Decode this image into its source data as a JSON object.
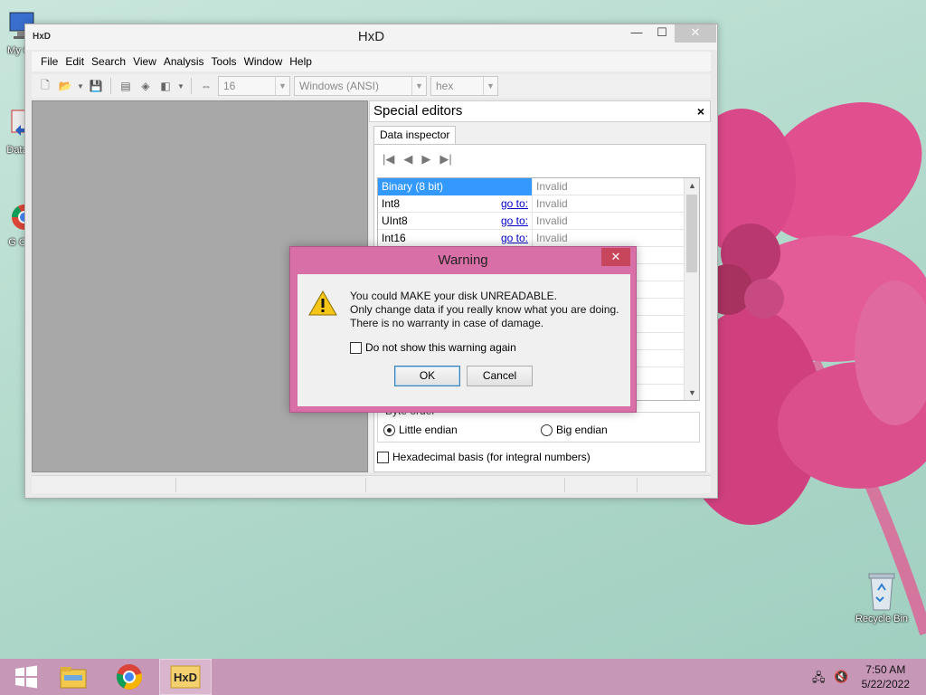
{
  "desktop": {
    "icons": [
      {
        "label": "My C"
      },
      {
        "label": "Data"
      },
      {
        "label": "G C"
      },
      {
        "label": "Recycle Bin"
      }
    ]
  },
  "window": {
    "title": "HxD",
    "app_icon": "HxD",
    "menu": [
      "File",
      "Edit",
      "Search",
      "View",
      "Analysis",
      "Tools",
      "Window",
      "Help"
    ],
    "toolbar": {
      "bytes_per_row": "16",
      "charset": "Windows (ANSI)",
      "offset_base": "hex"
    }
  },
  "special_editors": {
    "title": "Special editors",
    "close_label": "×",
    "tab": "Data inspector",
    "rows": [
      {
        "name": "Binary (8 bit)",
        "goto": "",
        "value": "Invalid",
        "selected": true
      },
      {
        "name": "Int8",
        "goto": "go to:",
        "value": "Invalid"
      },
      {
        "name": "UInt8",
        "goto": "go to:",
        "value": "Invalid"
      },
      {
        "name": "Int16",
        "goto": "go to:",
        "value": "Invalid"
      }
    ],
    "byte_order": {
      "legend": "Byte order",
      "little": "Little endian",
      "big": "Big endian",
      "selected": "little"
    },
    "hex_basis": "Hexadecimal basis (for integral numbers)"
  },
  "dialog": {
    "title": "Warning",
    "close_label": "✕",
    "lines": [
      "You could MAKE your disk UNREADABLE.",
      "Only change data if you really know what you are doing.",
      "There is no warranty in case of damage."
    ],
    "checkbox_label": "Do not show this warning again",
    "ok": "OK",
    "cancel": "Cancel"
  },
  "taskbar": {
    "time": "7:50 AM",
    "date": "5/22/2022",
    "hxd_label": "HxD"
  },
  "colors": {
    "dialog_frame": "#d96fa7",
    "taskbar": "#c797b8",
    "selection": "#3399ff",
    "link": "#0000cc"
  }
}
